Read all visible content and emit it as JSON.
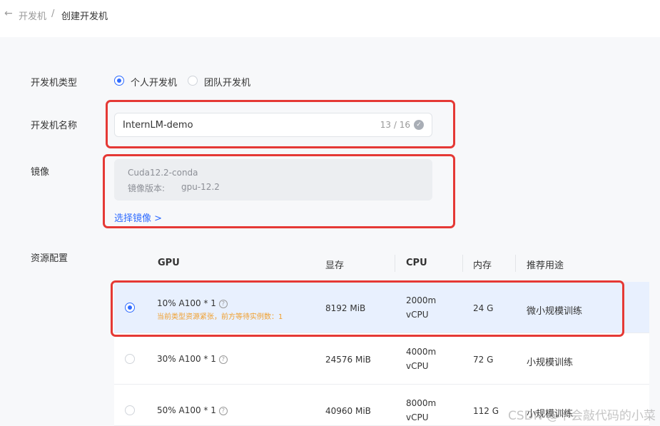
{
  "breadcrumb": {
    "parent": "开发机",
    "separator": "/",
    "current": "创建开发机"
  },
  "form": {
    "type_label": "开发机类型",
    "type_options": [
      "个人开发机",
      "团队开发机"
    ],
    "type_selected": "个人开发机",
    "name_label": "开发机名称",
    "name_value": "InternLM-demo",
    "name_count": "13 / 16",
    "image_label": "镜像",
    "image_name": "Cuda12.2-conda",
    "image_version_label": "镜像版本:",
    "image_version_value": "gpu-12.2",
    "select_image": "选择镜像 >",
    "resource_label": "资源配置"
  },
  "table": {
    "headers": [
      "GPU",
      "显存",
      "CPU",
      "内存",
      "推荐用途"
    ],
    "rows": [
      {
        "gpu": "10% A100 * 1",
        "warning": "当前类型资源紧张，前方等待实例数：1",
        "memory": "8192 MiB",
        "cpu_line1": "2000m",
        "cpu_line2": "vCPU",
        "ram": "24 G",
        "usage": "微小规模训练",
        "selected": true
      },
      {
        "gpu": "30% A100 * 1",
        "memory": "24576 MiB",
        "cpu_line1": "4000m",
        "cpu_line2": "vCPU",
        "ram": "72 G",
        "usage": "小规模训练",
        "selected": false
      },
      {
        "gpu": "50% A100 * 1",
        "memory": "40960 MiB",
        "cpu_line1": "8000m",
        "cpu_line2": "vCPU",
        "ram": "112 G",
        "usage": "小规模训练",
        "selected": false
      }
    ]
  },
  "watermark": "CSDN @不会敲代码的小菜",
  "colors": {
    "accent": "#2f6bff",
    "highlight": "#e53935",
    "warning": "#f0a030"
  },
  "icons": {
    "back": "arrow-left-icon",
    "valid": "check-circle-icon",
    "help": "question-circle-icon"
  }
}
